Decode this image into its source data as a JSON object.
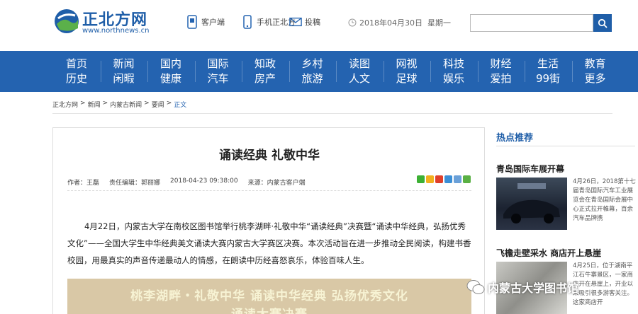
{
  "header": {
    "logo_text": "正北方网",
    "logo_url": "www.northnews.cn",
    "links": [
      {
        "label": "客户端",
        "icon": "phone-app-icon"
      },
      {
        "label": "手机正北方",
        "icon": "mobile-icon"
      },
      {
        "label": "投稿",
        "icon": "mail-icon"
      }
    ],
    "date": "2018年04月30日",
    "weekday": "星期一",
    "search": {
      "placeholder": "",
      "button_icon": "search-icon"
    }
  },
  "nav": {
    "columns": [
      [
        "首页",
        "历史"
      ],
      [
        "新闻",
        "闲暇"
      ],
      [
        "国内",
        "健康"
      ],
      [
        "国际",
        "汽车"
      ],
      [
        "知政",
        "房产"
      ],
      [
        "乡村",
        "旅游"
      ],
      [
        "读图",
        "人文"
      ],
      [
        "网视",
        "足球"
      ],
      [
        "科技",
        "娱乐"
      ],
      [
        "财经",
        "爱拍"
      ],
      [
        "生活",
        "99街"
      ],
      [
        "教育",
        "更多"
      ]
    ]
  },
  "breadcrumb": {
    "items": [
      "正北方网",
      "新闻",
      "内蒙古新闻",
      "要闻"
    ],
    "separator": ">",
    "current": "正文"
  },
  "article": {
    "title": "诵读经典 礼敬中华",
    "author": "作者：王磊",
    "editor": "责任编辑：郭丽娜",
    "datetime": "2018-04-23 09:38:00",
    "source": "来源：内蒙古客户端",
    "paragraph": "4月22日，内蒙古大学在南校区图书馆举行桃李湖畔·礼敬中华“诵读经典”决赛暨“诵读中华经典，弘扬优秀文化”——全国大学生中华经典美文诵读大赛内蒙古大学赛区决赛。本次活动旨在进一步推动全民阅读，构建书香校园，用最真实的声音传递最动人的情感，在朗读中历经喜怒哀乐，体验百味人生。",
    "banner_line1": "桃李湖畔・礼敬中华 诵读中华经典 弘扬优秀文化",
    "banner_line2": "诵读大赛决赛"
  },
  "sidebar": {
    "heading": "热点推荐",
    "items": [
      {
        "title": "青岛国际车展开幕",
        "text": "4月26日，2018第十七届青岛国际汽车工业展览会在青岛国际会展中心正式拉开帷幕，百余汽车品牌携"
      },
      {
        "title": "飞檐走壁采水 商店开上悬崖",
        "text": "4月25日，位于湖南平江石牛寨景区，一家商店开在悬崖上，开业以来吸引很多游客关注。这家商店开"
      }
    ]
  },
  "watermark": "内蒙古大学图书馆",
  "colors": {
    "brand": "#2463b0",
    "nav_bg": "#2463b0",
    "link": "#1f5ea8"
  }
}
